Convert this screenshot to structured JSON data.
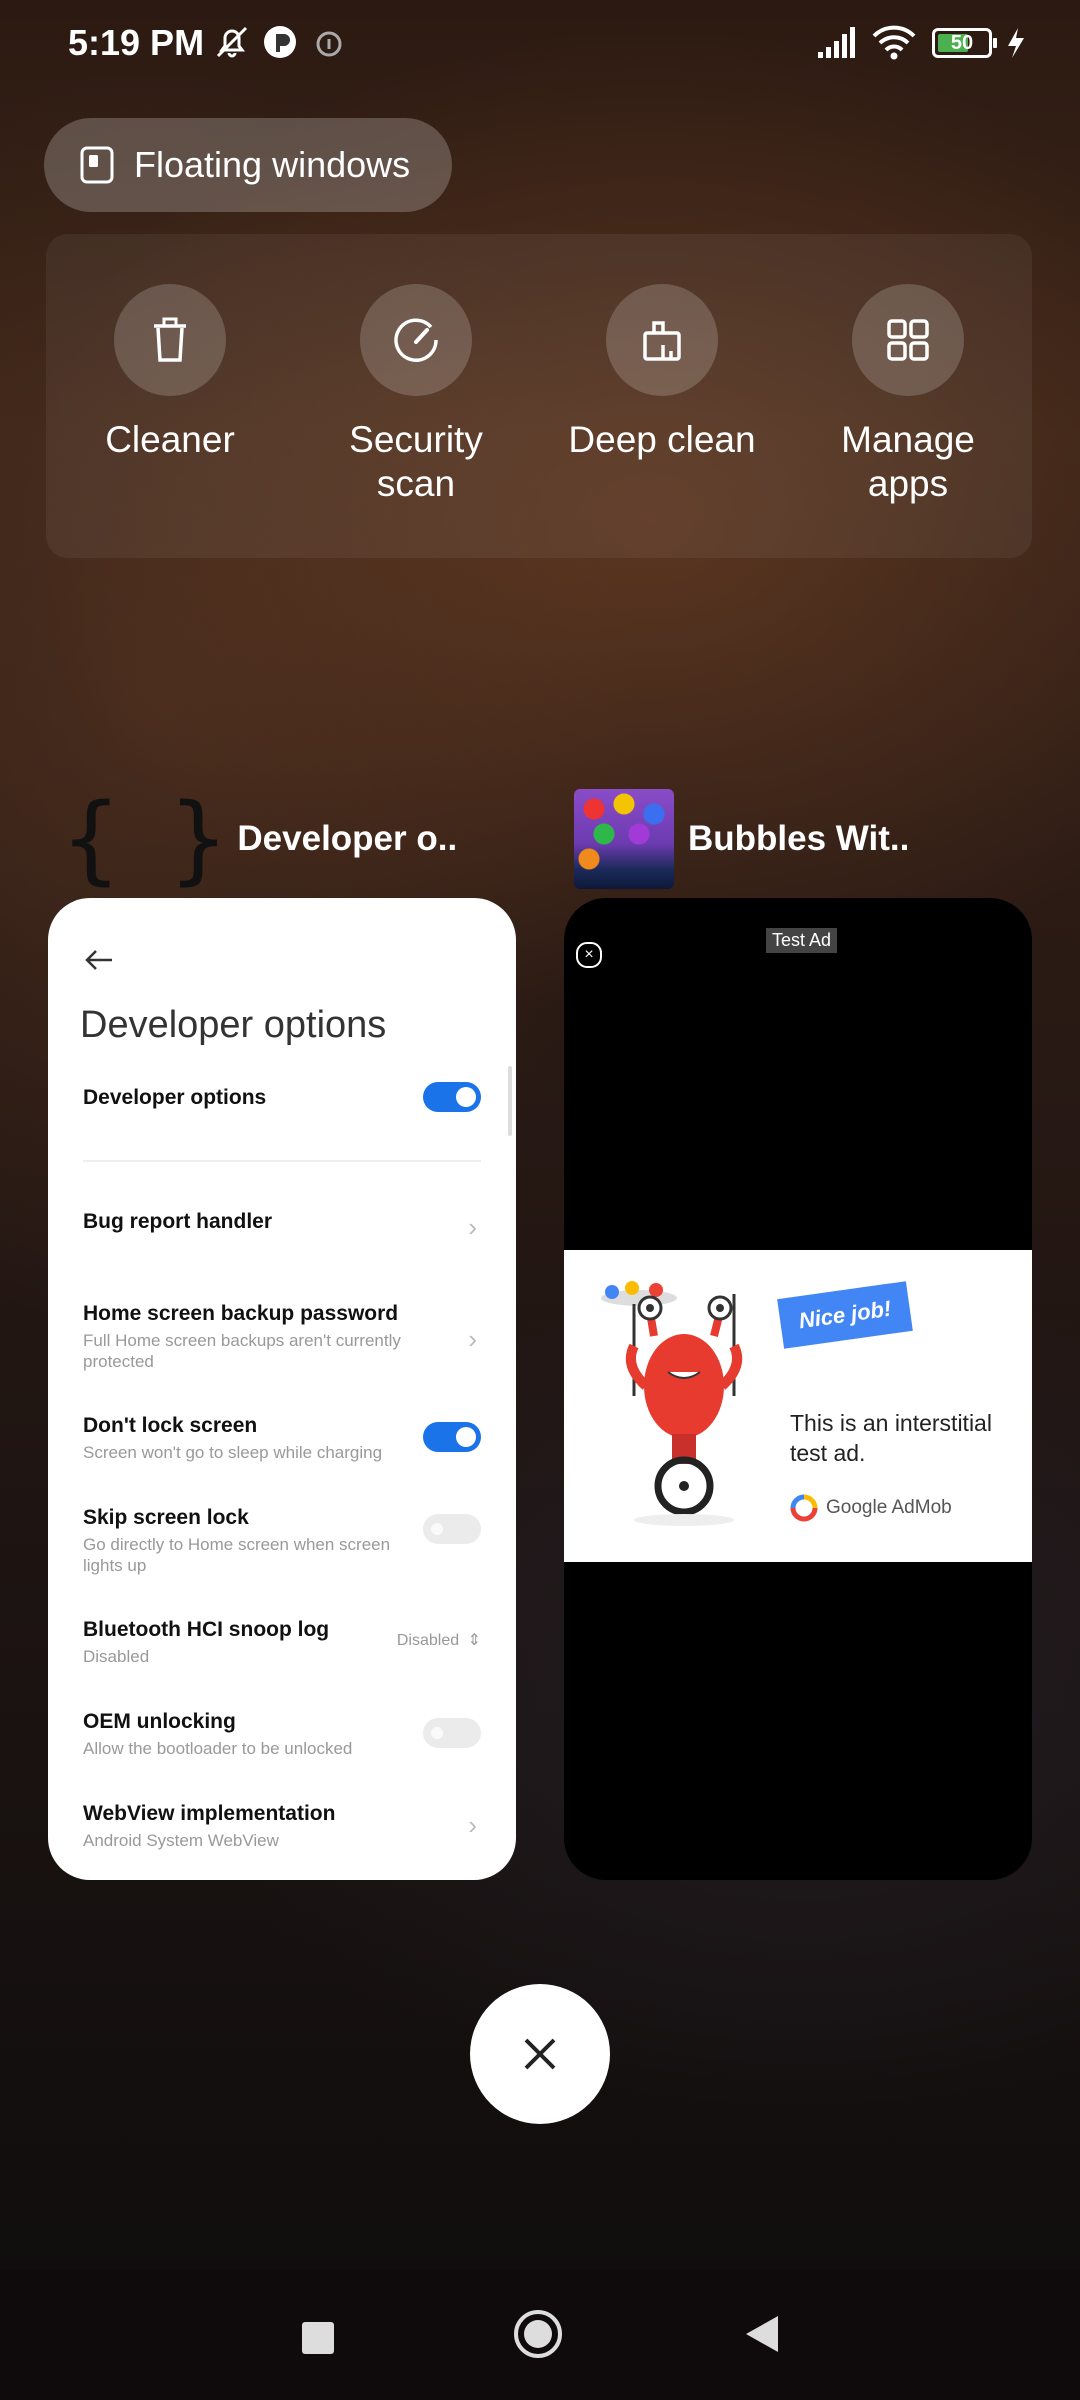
{
  "status_bar": {
    "time": "5:19 PM",
    "battery": "50"
  },
  "floating_windows": {
    "label": "Floating windows"
  },
  "quick_actions": [
    {
      "label": "Cleaner",
      "icon": "trash-icon"
    },
    {
      "label": "Security scan",
      "icon": "security-gauge-icon"
    },
    {
      "label": "Deep clean",
      "icon": "broom-bag-icon"
    },
    {
      "label": "Manage apps",
      "icon": "grid-apps-icon"
    }
  ],
  "recent_apps": {
    "dev": {
      "header": "Developer o..",
      "screen_title": "Developer options",
      "main_toggle_label": "Developer options",
      "items": [
        {
          "title": "Bug report handler",
          "subtitle": ""
        },
        {
          "title": "Home screen backup password",
          "subtitle": "Full Home screen backups aren't currently protected"
        },
        {
          "title": "Don't lock screen",
          "subtitle": "Screen won't go to sleep while charging"
        },
        {
          "title": "Skip screen lock",
          "subtitle": "Go directly to Home screen when screen lights up"
        },
        {
          "title": "Bluetooth HCI snoop log",
          "subtitle": "Disabled",
          "value": "Disabled"
        },
        {
          "title": "OEM unlocking",
          "subtitle": "Allow the bootloader to be unlocked"
        },
        {
          "title": "WebView implementation",
          "subtitle": "Android System WebView"
        }
      ]
    },
    "game": {
      "header": "Bubbles Wit..",
      "test_ad_label": "Test Ad",
      "nice_job": "Nice job!",
      "ad_text": "This is an interstitial test ad.",
      "admob_brand": "Google AdMob"
    }
  },
  "colors": {
    "toggle_on": "#1a73e8",
    "battery": "#4caf50"
  }
}
